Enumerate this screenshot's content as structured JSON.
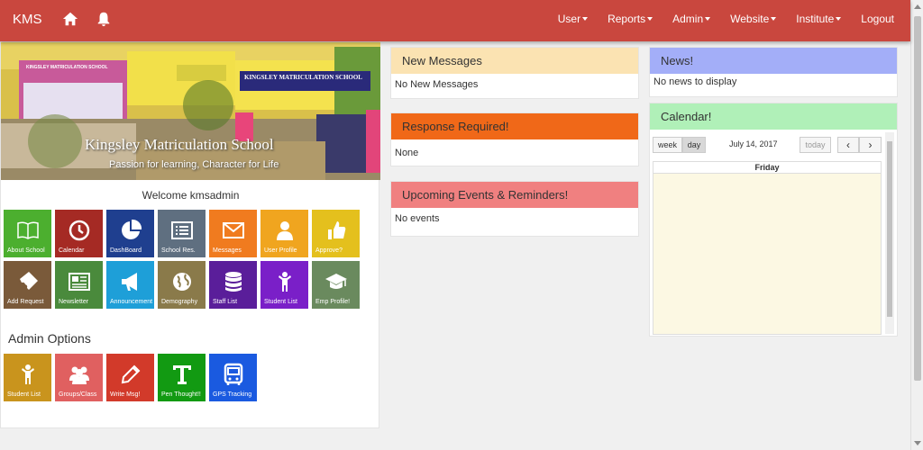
{
  "navbar": {
    "brand": "KMS",
    "home_icon": "home-icon",
    "bell_icon": "bell-icon",
    "menu": [
      "User",
      "Reports",
      "Admin",
      "Website",
      "Institute"
    ],
    "logout": "Logout"
  },
  "banner": {
    "title": "Kingsley Matriculation School",
    "subtitle": "Passion for learning, Character for Life",
    "sign_main": "KINGSLEY MATRICULATION SCHOOL",
    "sign_small": "KINGSLEY MATRICULATION SCHOOL"
  },
  "welcome": "Welcome kmsadmin",
  "tiles": [
    {
      "label": "About School",
      "icon": "book-icon",
      "color": "#4caf2f"
    },
    {
      "label": "Calendar",
      "icon": "clock-icon",
      "color": "#a52a24"
    },
    {
      "label": "DashBoard",
      "icon": "pie-chart-icon",
      "color": "#1f3f8f"
    },
    {
      "label": "School Res.",
      "icon": "list-icon",
      "color": "#5f6f80"
    },
    {
      "label": "Messages",
      "icon": "envelope-icon",
      "color": "#f07b1f"
    },
    {
      "label": "User Profile",
      "icon": "user-icon",
      "color": "#f0a51f"
    },
    {
      "label": "Approve?",
      "icon": "thumbs-up-icon",
      "color": "#e4c01d"
    },
    {
      "label": "Add Request",
      "icon": "ticket-icon",
      "color": "#7a5a3a"
    },
    {
      "label": "Newsletter",
      "icon": "newspaper-icon",
      "color": "#4a8a3c"
    },
    {
      "label": "Announcement",
      "icon": "megaphone-icon",
      "color": "#1e9fd8"
    },
    {
      "label": "Demography",
      "icon": "globe-icon",
      "color": "#8a7a4a"
    },
    {
      "label": "Staff List",
      "icon": "database-icon",
      "color": "#5a1e9a"
    },
    {
      "label": "Student List",
      "icon": "child-icon",
      "color": "#7a1fc8"
    },
    {
      "label": "Emp Profile!",
      "icon": "graduation-cap-icon",
      "color": "#6a8a5e"
    }
  ],
  "admin": {
    "heading": "Admin Options",
    "tiles": [
      {
        "label": "Student List",
        "icon": "child-icon",
        "color": "#c9941d"
      },
      {
        "label": "Groups/Class",
        "icon": "users-icon",
        "color": "#e06060"
      },
      {
        "label": "Write Msg!",
        "icon": "pencil-icon",
        "color": "#d23a2a"
      },
      {
        "label": "Pen Thought!!",
        "icon": "text-icon",
        "color": "#129a12"
      },
      {
        "label": "GPS Tracking",
        "icon": "bus-icon",
        "color": "#1a5ae0"
      }
    ]
  },
  "panels": {
    "messages": {
      "title": "New Messages",
      "body": "No New Messages",
      "color": "#fbe3b2"
    },
    "response": {
      "title": "Response Required!",
      "body": "None",
      "color": "#f06818"
    },
    "events": {
      "title": "Upcoming Events & Reminders!",
      "body": "No events",
      "color": "#f08080"
    },
    "news": {
      "title": "News!",
      "body": "No news to display",
      "color": "#a3aef8"
    },
    "calendar": {
      "title": "Calendar!",
      "color": "#b0f0b8",
      "week": "week",
      "day": "day",
      "date": "July 14, 2017",
      "today": "today",
      "prev": "‹",
      "next": "›",
      "day_header": "Friday"
    }
  }
}
